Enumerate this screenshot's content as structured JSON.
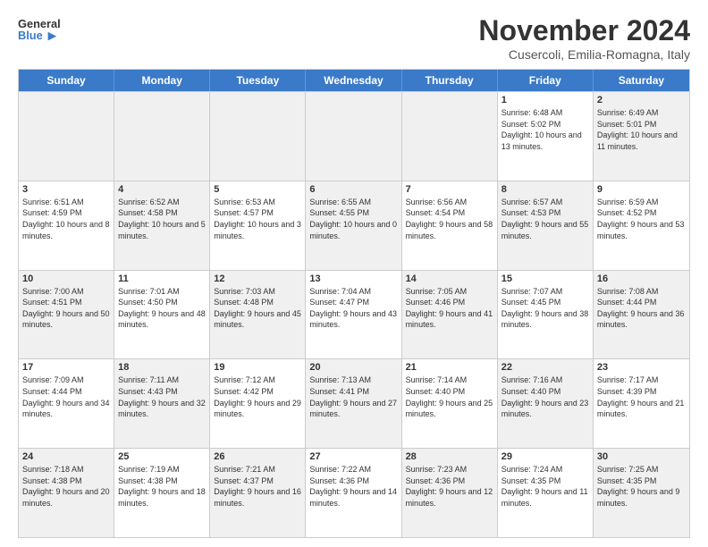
{
  "logo": {
    "line1": "General",
    "line2": "Blue"
  },
  "title": "November 2024",
  "subtitle": "Cusercoli, Emilia-Romagna, Italy",
  "days_of_week": [
    "Sunday",
    "Monday",
    "Tuesday",
    "Wednesday",
    "Thursday",
    "Friday",
    "Saturday"
  ],
  "rows": [
    [
      {
        "day": "",
        "info": "",
        "shaded": true
      },
      {
        "day": "",
        "info": "",
        "shaded": true
      },
      {
        "day": "",
        "info": "",
        "shaded": true
      },
      {
        "day": "",
        "info": "",
        "shaded": true
      },
      {
        "day": "",
        "info": "",
        "shaded": true
      },
      {
        "day": "1",
        "info": "Sunrise: 6:48 AM\nSunset: 5:02 PM\nDaylight: 10 hours and 13 minutes.",
        "shaded": false
      },
      {
        "day": "2",
        "info": "Sunrise: 6:49 AM\nSunset: 5:01 PM\nDaylight: 10 hours and 11 minutes.",
        "shaded": true
      }
    ],
    [
      {
        "day": "3",
        "info": "Sunrise: 6:51 AM\nSunset: 4:59 PM\nDaylight: 10 hours and 8 minutes.",
        "shaded": false
      },
      {
        "day": "4",
        "info": "Sunrise: 6:52 AM\nSunset: 4:58 PM\nDaylight: 10 hours and 5 minutes.",
        "shaded": true
      },
      {
        "day": "5",
        "info": "Sunrise: 6:53 AM\nSunset: 4:57 PM\nDaylight: 10 hours and 3 minutes.",
        "shaded": false
      },
      {
        "day": "6",
        "info": "Sunrise: 6:55 AM\nSunset: 4:55 PM\nDaylight: 10 hours and 0 minutes.",
        "shaded": true
      },
      {
        "day": "7",
        "info": "Sunrise: 6:56 AM\nSunset: 4:54 PM\nDaylight: 9 hours and 58 minutes.",
        "shaded": false
      },
      {
        "day": "8",
        "info": "Sunrise: 6:57 AM\nSunset: 4:53 PM\nDaylight: 9 hours and 55 minutes.",
        "shaded": true
      },
      {
        "day": "9",
        "info": "Sunrise: 6:59 AM\nSunset: 4:52 PM\nDaylight: 9 hours and 53 minutes.",
        "shaded": false
      }
    ],
    [
      {
        "day": "10",
        "info": "Sunrise: 7:00 AM\nSunset: 4:51 PM\nDaylight: 9 hours and 50 minutes.",
        "shaded": true
      },
      {
        "day": "11",
        "info": "Sunrise: 7:01 AM\nSunset: 4:50 PM\nDaylight: 9 hours and 48 minutes.",
        "shaded": false
      },
      {
        "day": "12",
        "info": "Sunrise: 7:03 AM\nSunset: 4:48 PM\nDaylight: 9 hours and 45 minutes.",
        "shaded": true
      },
      {
        "day": "13",
        "info": "Sunrise: 7:04 AM\nSunset: 4:47 PM\nDaylight: 9 hours and 43 minutes.",
        "shaded": false
      },
      {
        "day": "14",
        "info": "Sunrise: 7:05 AM\nSunset: 4:46 PM\nDaylight: 9 hours and 41 minutes.",
        "shaded": true
      },
      {
        "day": "15",
        "info": "Sunrise: 7:07 AM\nSunset: 4:45 PM\nDaylight: 9 hours and 38 minutes.",
        "shaded": false
      },
      {
        "day": "16",
        "info": "Sunrise: 7:08 AM\nSunset: 4:44 PM\nDaylight: 9 hours and 36 minutes.",
        "shaded": true
      }
    ],
    [
      {
        "day": "17",
        "info": "Sunrise: 7:09 AM\nSunset: 4:44 PM\nDaylight: 9 hours and 34 minutes.",
        "shaded": false
      },
      {
        "day": "18",
        "info": "Sunrise: 7:11 AM\nSunset: 4:43 PM\nDaylight: 9 hours and 32 minutes.",
        "shaded": true
      },
      {
        "day": "19",
        "info": "Sunrise: 7:12 AM\nSunset: 4:42 PM\nDaylight: 9 hours and 29 minutes.",
        "shaded": false
      },
      {
        "day": "20",
        "info": "Sunrise: 7:13 AM\nSunset: 4:41 PM\nDaylight: 9 hours and 27 minutes.",
        "shaded": true
      },
      {
        "day": "21",
        "info": "Sunrise: 7:14 AM\nSunset: 4:40 PM\nDaylight: 9 hours and 25 minutes.",
        "shaded": false
      },
      {
        "day": "22",
        "info": "Sunrise: 7:16 AM\nSunset: 4:40 PM\nDaylight: 9 hours and 23 minutes.",
        "shaded": true
      },
      {
        "day": "23",
        "info": "Sunrise: 7:17 AM\nSunset: 4:39 PM\nDaylight: 9 hours and 21 minutes.",
        "shaded": false
      }
    ],
    [
      {
        "day": "24",
        "info": "Sunrise: 7:18 AM\nSunset: 4:38 PM\nDaylight: 9 hours and 20 minutes.",
        "shaded": true
      },
      {
        "day": "25",
        "info": "Sunrise: 7:19 AM\nSunset: 4:38 PM\nDaylight: 9 hours and 18 minutes.",
        "shaded": false
      },
      {
        "day": "26",
        "info": "Sunrise: 7:21 AM\nSunset: 4:37 PM\nDaylight: 9 hours and 16 minutes.",
        "shaded": true
      },
      {
        "day": "27",
        "info": "Sunrise: 7:22 AM\nSunset: 4:36 PM\nDaylight: 9 hours and 14 minutes.",
        "shaded": false
      },
      {
        "day": "28",
        "info": "Sunrise: 7:23 AM\nSunset: 4:36 PM\nDaylight: 9 hours and 12 minutes.",
        "shaded": true
      },
      {
        "day": "29",
        "info": "Sunrise: 7:24 AM\nSunset: 4:35 PM\nDaylight: 9 hours and 11 minutes.",
        "shaded": false
      },
      {
        "day": "30",
        "info": "Sunrise: 7:25 AM\nSunset: 4:35 PM\nDaylight: 9 hours and 9 minutes.",
        "shaded": true
      }
    ]
  ]
}
